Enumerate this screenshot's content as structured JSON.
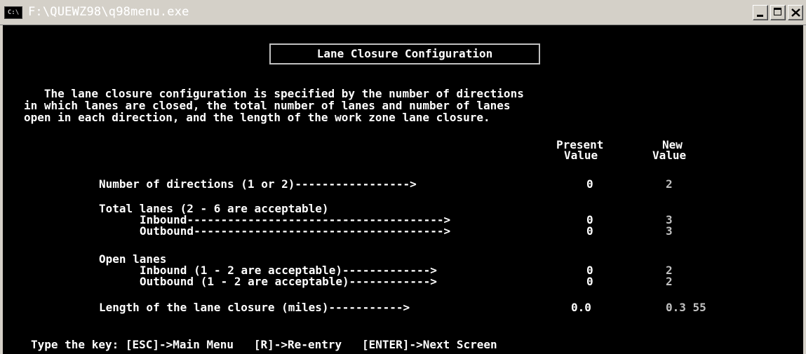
{
  "window": {
    "icon_text": "C:\\",
    "title": "F:\\QUEWZ98\\q98menu.exe",
    "controls": [
      "minimize",
      "maximize",
      "close"
    ]
  },
  "screen": {
    "heading": "Lane Closure Configuration",
    "intro": [
      "   The lane closure configuration is specified by the number of directions",
      "in which lanes are closed, the total number of lanes and number of lanes",
      "open in each direction, and the length of the work zone lane closure."
    ],
    "columns": {
      "present_line1": "Present",
      "present_line2": "Value",
      "new_line1": "New",
      "new_line2": "Value"
    },
    "rows": {
      "directions": {
        "label": "Number of directions (1 or 2)----------------->",
        "present": "0",
        "new": "2"
      },
      "total_heading": "Total lanes (2 - 6 are acceptable)",
      "total_inbound": {
        "label": "Inbound-------------------------------------->",
        "present": "0",
        "new": "3"
      },
      "total_outbound": {
        "label": "Outbound------------------------------------->",
        "present": "0",
        "new": "3"
      },
      "open_heading": "Open lanes",
      "open_inbound": {
        "label": "Inbound (1 - 2 are acceptable)------------->",
        "present": "0",
        "new": "2"
      },
      "open_outbound": {
        "label": "Outbound (1 - 2 are acceptable)------------>",
        "present": "0",
        "new": "2"
      },
      "length": {
        "label": "Length of the lane closure (miles)----------->",
        "present": "0.0",
        "new": "0.3 55"
      }
    },
    "footer": "Type the key: [ESC]->Main Menu   [R]->Re-entry   [ENTER]->Next Screen"
  },
  "colors": {
    "console_bg": "#000000",
    "console_text": "#c0c0c0",
    "titlebar": "#d4d0c8"
  }
}
